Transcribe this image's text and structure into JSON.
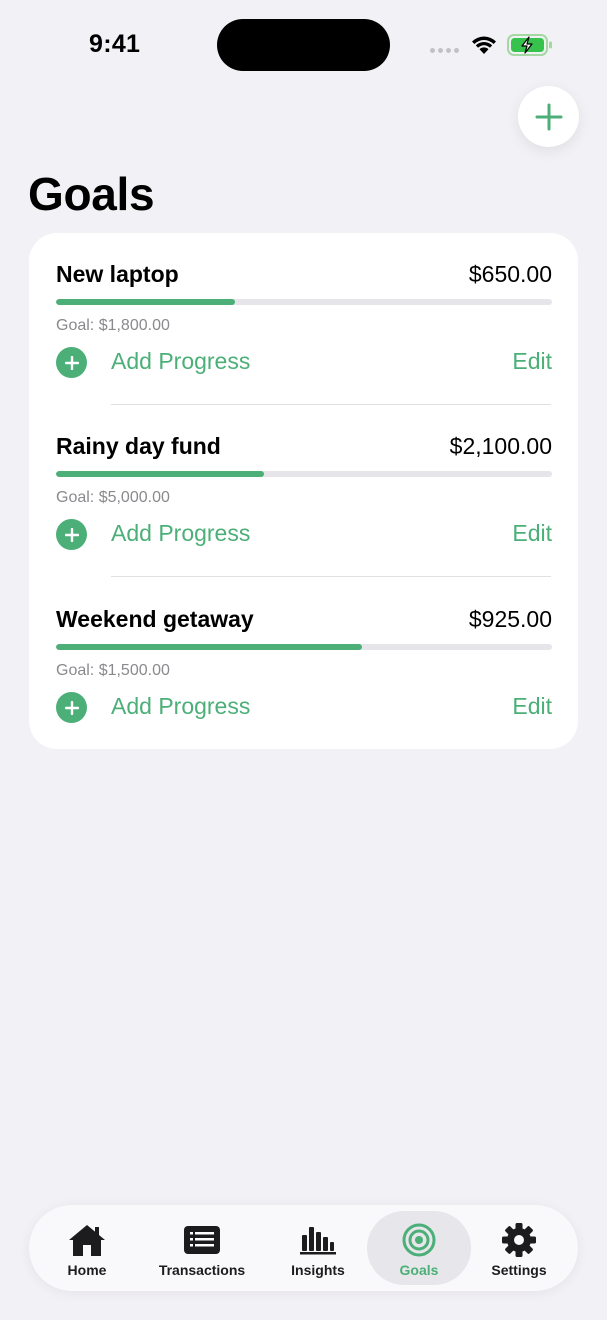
{
  "status_bar": {
    "time": "9:41"
  },
  "colors": {
    "accent": "#4caf78",
    "background": "#f2f1f6"
  },
  "header": {
    "title": "Goals",
    "add_icon": "plus-icon"
  },
  "goals": [
    {
      "name": "New laptop",
      "saved": "$650.00",
      "target": "Goal: $1,800.00",
      "progress": 0.361,
      "add_label": "Add Progress",
      "edit_label": "Edit"
    },
    {
      "name": "Rainy day fund",
      "saved": "$2,100.00",
      "target": "Goal: $5,000.00",
      "progress": 0.42,
      "add_label": "Add Progress",
      "edit_label": "Edit"
    },
    {
      "name": "Weekend getaway",
      "saved": "$925.00",
      "target": "Goal: $1,500.00",
      "progress": 0.617,
      "add_label": "Add Progress",
      "edit_label": "Edit"
    }
  ],
  "tabbar": {
    "items": [
      {
        "label": "Home",
        "icon": "house-icon"
      },
      {
        "label": "Transactions",
        "icon": "list-icon"
      },
      {
        "label": "Insights",
        "icon": "bar-chart-icon"
      },
      {
        "label": "Goals",
        "icon": "target-icon",
        "active": true
      },
      {
        "label": "Settings",
        "icon": "gear-icon"
      }
    ]
  }
}
